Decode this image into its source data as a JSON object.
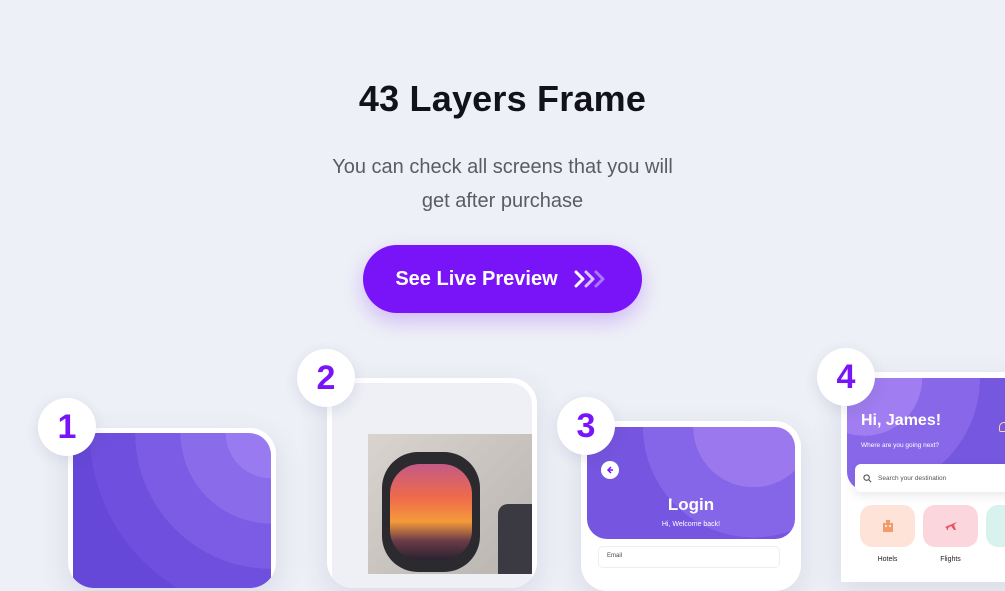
{
  "header": {
    "title": "43 Layers Frame",
    "subtitle_line1": "You can check all screens that you will",
    "subtitle_line2": "get after purchase"
  },
  "cta": {
    "label": "See Live Preview",
    "icon": "triple-chevron-right-icon",
    "color": "#7a14f8"
  },
  "screens": [
    {
      "number": "1"
    },
    {
      "number": "2"
    },
    {
      "number": "3",
      "title": "Login",
      "subtitle": "Hi, Welcome back!",
      "email_label": "Email"
    },
    {
      "number": "4",
      "greeting": "Hi, James!",
      "question": "Where are you going next?",
      "search_placeholder": "Search your destination",
      "categories": [
        {
          "label": "Hotels"
        },
        {
          "label": "Flights"
        }
      ]
    }
  ],
  "colors": {
    "accent": "#7a14f8",
    "background": "#eef0f7",
    "hotels_tile": "#fde3d8",
    "flights_tile": "#fbd6dc",
    "third_tile": "#d8f3ee"
  }
}
